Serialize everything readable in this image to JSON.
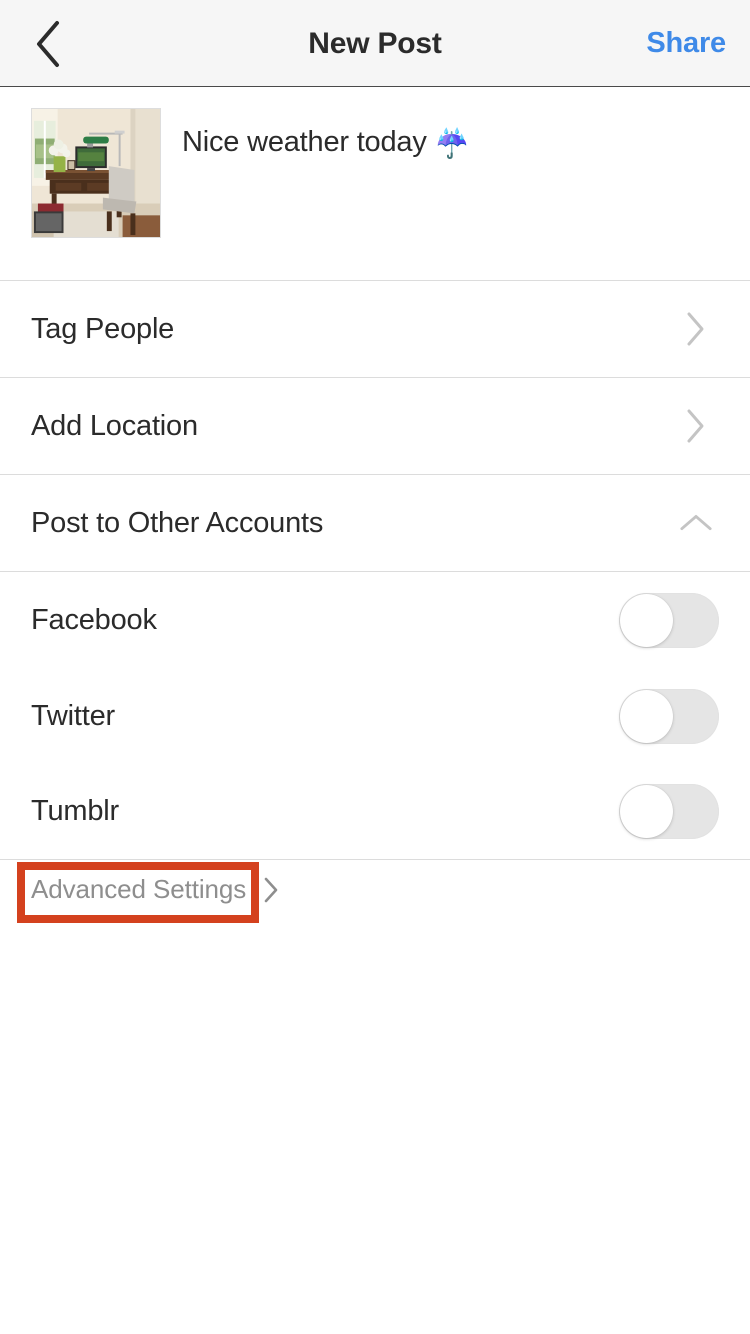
{
  "header": {
    "back_icon": "chevron-left-icon",
    "title": "New Post",
    "share_label": "Share",
    "share_color": "#3f8ae8",
    "background": "#f6f6f6"
  },
  "composer": {
    "thumbnail_alt": "Home office photo: wooden desk with laptop, green banker's lamp, flowers in a green vase and a gray upholstered chair",
    "caption_text": "Nice weather today",
    "caption_emoji": "☔"
  },
  "options": [
    {
      "label": "Tag People",
      "icon": "chevron-right-icon"
    },
    {
      "label": "Add Location",
      "icon": "chevron-right-icon"
    },
    {
      "label": "Post to Other Accounts",
      "icon": "chevron-up-icon"
    }
  ],
  "accounts": [
    {
      "label": "Facebook",
      "state": "off"
    },
    {
      "label": "Twitter",
      "state": "off"
    },
    {
      "label": "Tumblr",
      "state": "off"
    }
  ],
  "advanced": {
    "label": "Advanced Settings",
    "icon": "chevron-right-icon",
    "highlight_color": "#d4411e"
  }
}
